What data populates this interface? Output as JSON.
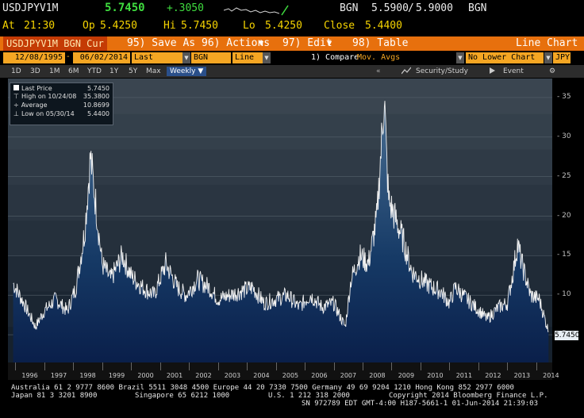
{
  "quote": {
    "ticker": "USDJPYV1M",
    "last": "5.7450",
    "change": "+.3050",
    "source_label": "BGN",
    "bid": "5.5900",
    "ask": "5.9000",
    "source_label2": "BGN",
    "at_label": "At",
    "time": "21:30",
    "op_label": "Op",
    "open": "5.4250",
    "hi_label": "Hi",
    "high": "5.7450",
    "lo_label": "Lo",
    "low": "5.4250",
    "close_label": "Close",
    "close": "5.4400"
  },
  "actionbar": {
    "security": "USDJPYV1M BGN Cur",
    "save": "95) Save As",
    "actions": "96) Actions",
    "edit": "97) Edit",
    "table": "98) Table",
    "title": "Line Chart"
  },
  "fields": {
    "start_date": "12/08/1995",
    "end_date": "06/02/2014",
    "field": "Last Price",
    "source": "BGN",
    "style": "Line",
    "compare": "1) Compare",
    "mov_avgs": "Mov. Avgs",
    "lower_chart": "No Lower Chart",
    "currency": "JPY"
  },
  "toolbar": {
    "periods": [
      "1D",
      "3D",
      "1M",
      "6M",
      "YTD",
      "1Y",
      "5Y",
      "Max"
    ],
    "frequency": "Weekly",
    "security_study": "Security/Study",
    "event": "Event"
  },
  "legend": {
    "items": [
      {
        "label": "Last Price",
        "value": "5.7450"
      },
      {
        "label": "High on 10/24/08",
        "value": "35.3800"
      },
      {
        "label": "Average",
        "value": "10.8699"
      },
      {
        "label": "Low on 05/30/14",
        "value": "5.4400"
      }
    ]
  },
  "chart_data": {
    "type": "area",
    "series": [
      {
        "values_note": "weekly 1M USDJPY implied vol"
      }
    ],
    "x": [
      1995.93,
      1996.3,
      1996.7,
      1997.0,
      1997.4,
      1997.8,
      1998.1,
      1998.4,
      1998.6,
      1998.8,
      1999.0,
      1999.3,
      1999.7,
      2000.0,
      2000.4,
      2000.8,
      2001.2,
      2001.6,
      2001.9,
      2002.3,
      2002.7,
      2003.0,
      2003.4,
      2003.8,
      2004.2,
      2004.6,
      2005.0,
      2005.4,
      2005.8,
      2006.2,
      2006.6,
      2007.0,
      2007.4,
      2007.6,
      2007.9,
      2008.2,
      2008.5,
      2008.75,
      2008.82,
      2008.9,
      2009.1,
      2009.4,
      2009.7,
      2010.0,
      2010.4,
      2010.7,
      2011.0,
      2011.2,
      2011.6,
      2011.9,
      2012.3,
      2012.7,
      2013.0,
      2013.2,
      2013.35,
      2013.5,
      2013.8,
      2014.1,
      2014.42
    ],
    "y": [
      11.5,
      9,
      6,
      8,
      9.5,
      8,
      11,
      18,
      27.5,
      21,
      14,
      12,
      15,
      12.5,
      11,
      10,
      14,
      11,
      10,
      12,
      11,
      9.5,
      10,
      10.5,
      11,
      9,
      9.5,
      10,
      8.5,
      10,
      8.5,
      9,
      6,
      12,
      15,
      14,
      20,
      35.38,
      28,
      22,
      20,
      17,
      13,
      12,
      11,
      10.5,
      9,
      11,
      9.5,
      8.5,
      7,
      8.5,
      9,
      13,
      16.5,
      14,
      10,
      9.5,
      5.44
    ],
    "ylim": [
      5,
      36
    ],
    "yticks": [
      5,
      10,
      15,
      20,
      25,
      30,
      35
    ],
    "xticks": [
      "1996",
      "1997",
      "1998",
      "1999",
      "2000",
      "2001",
      "2002",
      "2003",
      "2004",
      "2005",
      "2006",
      "2007",
      "2008",
      "2009",
      "2010",
      "2011",
      "2012",
      "2013",
      "2014"
    ],
    "last_label": "5.7450",
    "grid": true
  },
  "footer": {
    "line1": "Australia 61 2 9777 8600 Brazil 5511 3048 4500 Europe 44 20 7330 7500 Germany 49 69 9204 1210 Hong Kong 852 2977 6000",
    "line2a": "Japan 81 3 3201 8900",
    "line2b": "Singapore 65 6212 1000",
    "line2c": "U.S. 1 212 318 2000",
    "line2d": "Copyright 2014 Bloomberg Finance L.P.",
    "line3": "SN 972789 EDT  GMT-4:00 H187-5661-1 01-Jun-2014 21:39:03"
  }
}
